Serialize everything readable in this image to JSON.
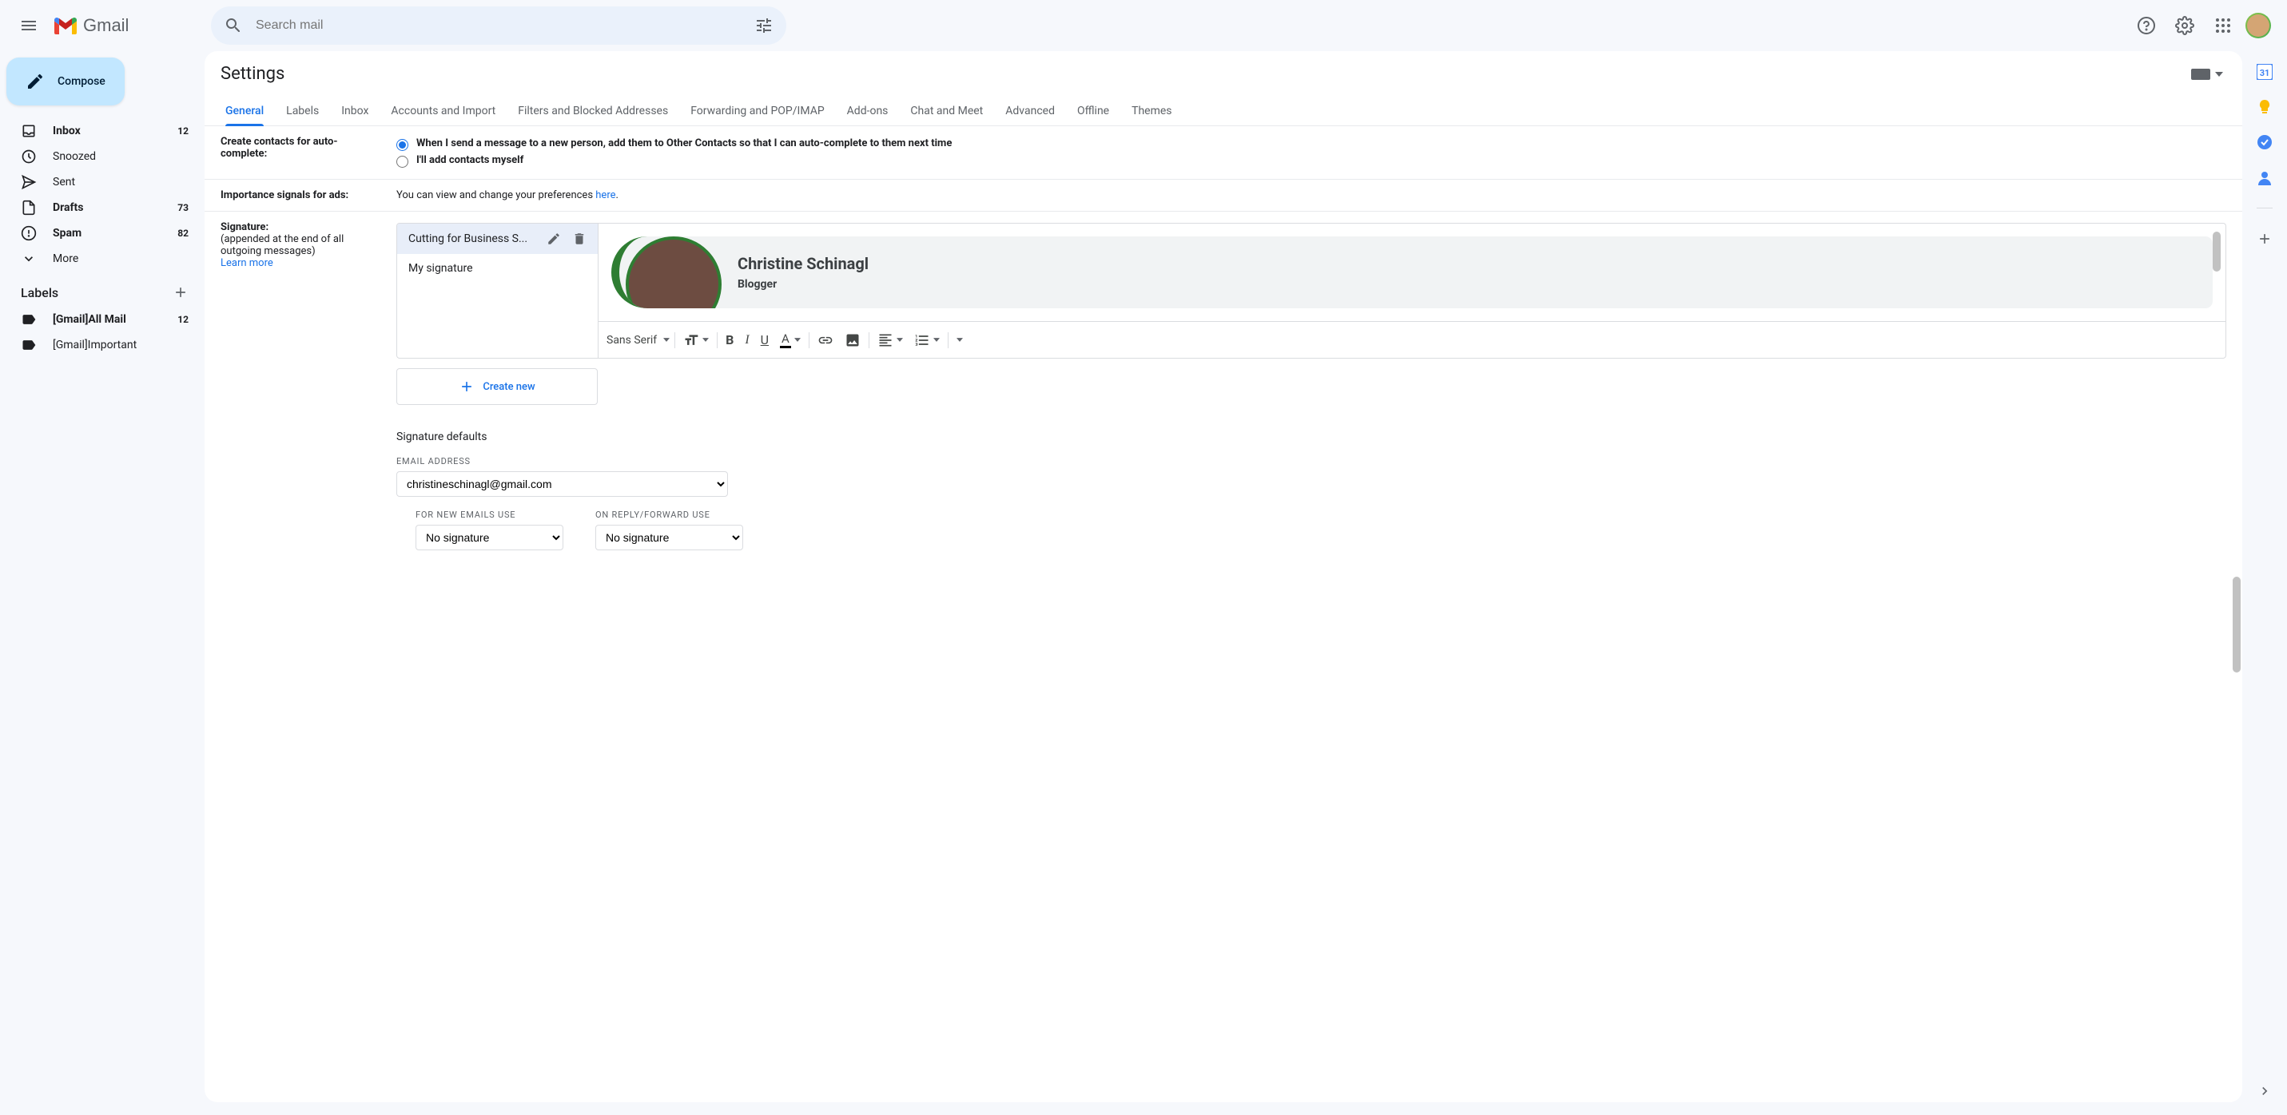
{
  "header": {
    "brand": "Gmail",
    "search_placeholder": "Search mail"
  },
  "compose_label": "Compose",
  "sidebar": {
    "items": [
      {
        "icon": "inbox",
        "label": "Inbox",
        "count": "12",
        "bold": true
      },
      {
        "icon": "clock",
        "label": "Snoozed",
        "count": "",
        "bold": false
      },
      {
        "icon": "sent",
        "label": "Sent",
        "count": "",
        "bold": false
      },
      {
        "icon": "file",
        "label": "Drafts",
        "count": "73",
        "bold": true
      },
      {
        "icon": "spam",
        "label": "Spam",
        "count": "82",
        "bold": true
      },
      {
        "icon": "more",
        "label": "More",
        "count": "",
        "bold": false
      }
    ],
    "labels_header": "Labels",
    "labels": [
      {
        "label": "[Gmail]All Mail",
        "count": "12",
        "bold": true
      },
      {
        "label": "[Gmail]Important",
        "count": "",
        "bold": false
      }
    ]
  },
  "settings": {
    "title": "Settings",
    "tabs": [
      "General",
      "Labels",
      "Inbox",
      "Accounts and Import",
      "Filters and Blocked Addresses",
      "Forwarding and POP/IMAP",
      "Add-ons",
      "Chat and Meet",
      "Advanced",
      "Offline",
      "Themes"
    ],
    "active_tab": 0,
    "contacts": {
      "label": "Create contacts for auto-complete:",
      "opt1": "When I send a message to a new person, add them to Other Contacts so that I can auto-complete to them next time",
      "opt2": "I'll add contacts myself"
    },
    "ads": {
      "label": "Importance signals for ads:",
      "text_pre": "You can view and change your preferences ",
      "link": "here",
      "text_post": "."
    },
    "signature": {
      "label": "Signature:",
      "sub": "(appended at the end of all outgoing messages)",
      "learn_more": "Learn more",
      "list": [
        "Cutting for Business S...",
        "My signature"
      ],
      "preview_name": "Christine Schinagl",
      "preview_role": "Blogger",
      "font": "Sans Serif",
      "create_new": "Create new",
      "defaults_title": "Signature defaults",
      "email_label": "EMAIL ADDRESS",
      "email_value": "christineschinagl@gmail.com",
      "new_label": "FOR NEW EMAILS USE",
      "new_value": "No signature",
      "reply_label": "ON REPLY/FORWARD USE",
      "reply_value": "No signature"
    }
  }
}
